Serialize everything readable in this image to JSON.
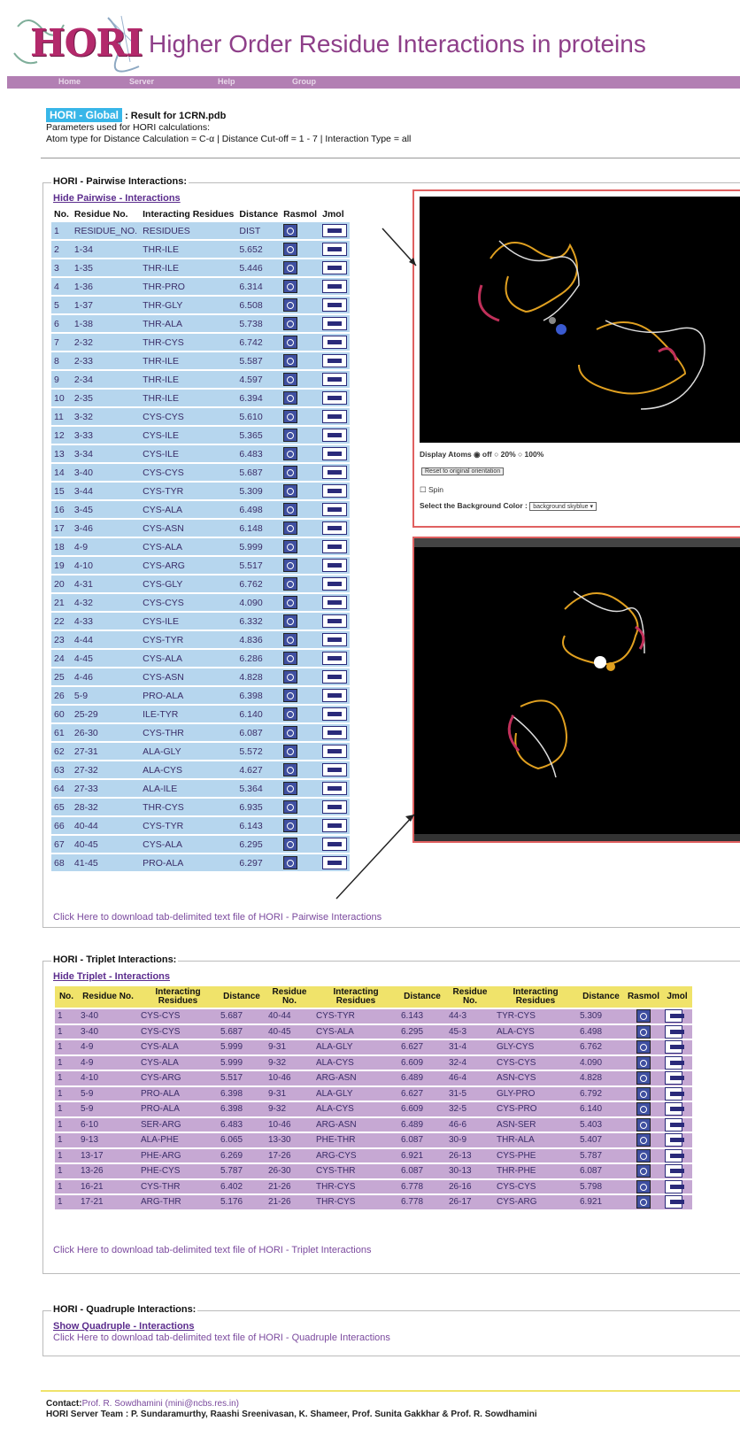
{
  "header": {
    "logo_text": "HORI",
    "title": "Higher Order Residue Interactions in proteins",
    "nav": [
      "Home",
      "Server",
      "Help",
      "Group"
    ]
  },
  "result": {
    "badge": "HORI - Global",
    "title": ": Result for 1CRN.pdb",
    "params_line1": "Parameters used for HORI calculations:",
    "params_line2": "Atom type for Distance Calculation = C-α | Distance Cut-off = 1 - 7 | Interaction Type = all"
  },
  "pairwise": {
    "legend": "HORI - Pairwise Interactions:",
    "toggle": "Hide Pairwise - Interactions",
    "headers": [
      "No.",
      "Residue No.",
      "Interacting Residues",
      "Distance",
      "Rasmol",
      "Jmol"
    ],
    "rows": [
      [
        "1",
        "RESIDUE_NO.",
        "RESIDUES",
        "DIST"
      ],
      [
        "2",
        "1-34",
        "THR-ILE",
        "5.652"
      ],
      [
        "3",
        "1-35",
        "THR-ILE",
        "5.446"
      ],
      [
        "4",
        "1-36",
        "THR-PRO",
        "6.314"
      ],
      [
        "5",
        "1-37",
        "THR-GLY",
        "6.508"
      ],
      [
        "6",
        "1-38",
        "THR-ALA",
        "5.738"
      ],
      [
        "7",
        "2-32",
        "THR-CYS",
        "6.742"
      ],
      [
        "8",
        "2-33",
        "THR-ILE",
        "5.587"
      ],
      [
        "9",
        "2-34",
        "THR-ILE",
        "4.597"
      ],
      [
        "10",
        "2-35",
        "THR-ILE",
        "6.394"
      ],
      [
        "11",
        "3-32",
        "CYS-CYS",
        "5.610"
      ],
      [
        "12",
        "3-33",
        "CYS-ILE",
        "5.365"
      ],
      [
        "13",
        "3-34",
        "CYS-ILE",
        "6.483"
      ],
      [
        "14",
        "3-40",
        "CYS-CYS",
        "5.687"
      ],
      [
        "15",
        "3-44",
        "CYS-TYR",
        "5.309"
      ],
      [
        "16",
        "3-45",
        "CYS-ALA",
        "6.498"
      ],
      [
        "17",
        "3-46",
        "CYS-ASN",
        "6.148"
      ],
      [
        "18",
        "4-9",
        "CYS-ALA",
        "5.999"
      ],
      [
        "19",
        "4-10",
        "CYS-ARG",
        "5.517"
      ],
      [
        "20",
        "4-31",
        "CYS-GLY",
        "6.762"
      ],
      [
        "21",
        "4-32",
        "CYS-CYS",
        "4.090"
      ],
      [
        "22",
        "4-33",
        "CYS-ILE",
        "6.332"
      ],
      [
        "23",
        "4-44",
        "CYS-TYR",
        "4.836"
      ],
      [
        "24",
        "4-45",
        "CYS-ALA",
        "6.286"
      ],
      [
        "25",
        "4-46",
        "CYS-ASN",
        "4.828"
      ],
      [
        "26",
        "5-9",
        "PRO-ALA",
        "6.398"
      ],
      [
        "60",
        "25-29",
        "ILE-TYR",
        "6.140"
      ],
      [
        "61",
        "26-30",
        "CYS-THR",
        "6.087"
      ],
      [
        "62",
        "27-31",
        "ALA-GLY",
        "5.572"
      ],
      [
        "63",
        "27-32",
        "ALA-CYS",
        "4.627"
      ],
      [
        "64",
        "27-33",
        "ALA-ILE",
        "5.364"
      ],
      [
        "65",
        "28-32",
        "THR-CYS",
        "6.935"
      ],
      [
        "66",
        "40-44",
        "CYS-TYR",
        "6.143"
      ],
      [
        "67",
        "40-45",
        "CYS-ALA",
        "6.295"
      ],
      [
        "68",
        "41-45",
        "PRO-ALA",
        "6.297"
      ]
    ],
    "download": "Click Here to download tab-delimited text file of HORI - Pairwise Interactions"
  },
  "viewer": {
    "display_atoms": "Display Atoms",
    "opt_off": "off",
    "opt_20": "20%",
    "opt_100": "100%",
    "reset_button": "Reset to original orientation",
    "spin": "Spin",
    "bg_label": "Select the Background Color :",
    "bg_value": "background skyblue"
  },
  "triplet": {
    "legend": "HORI - Triplet Interactions:",
    "toggle": "Hide Triplet - Interactions",
    "headers": [
      "No.",
      "Residue No.",
      "Interacting Residues",
      "Distance",
      "Residue No.",
      "Interacting Residues",
      "Distance",
      "Residue No.",
      "Interacting Residues",
      "Distance",
      "Rasmol",
      "Jmol"
    ],
    "rows": [
      [
        "1",
        "3-40",
        "CYS-CYS",
        "5.687",
        "40-44",
        "CYS-TYR",
        "6.143",
        "44-3",
        "TYR-CYS",
        "5.309"
      ],
      [
        "1",
        "3-40",
        "CYS-CYS",
        "5.687",
        "40-45",
        "CYS-ALA",
        "6.295",
        "45-3",
        "ALA-CYS",
        "6.498"
      ],
      [
        "1",
        "4-9",
        "CYS-ALA",
        "5.999",
        "9-31",
        "ALA-GLY",
        "6.627",
        "31-4",
        "GLY-CYS",
        "6.762"
      ],
      [
        "1",
        "4-9",
        "CYS-ALA",
        "5.999",
        "9-32",
        "ALA-CYS",
        "6.609",
        "32-4",
        "CYS-CYS",
        "4.090"
      ],
      [
        "1",
        "4-10",
        "CYS-ARG",
        "5.517",
        "10-46",
        "ARG-ASN",
        "6.489",
        "46-4",
        "ASN-CYS",
        "4.828"
      ],
      [
        "1",
        "5-9",
        "PRO-ALA",
        "6.398",
        "9-31",
        "ALA-GLY",
        "6.627",
        "31-5",
        "GLY-PRO",
        "6.792"
      ],
      [
        "1",
        "5-9",
        "PRO-ALA",
        "6.398",
        "9-32",
        "ALA-CYS",
        "6.609",
        "32-5",
        "CYS-PRO",
        "6.140"
      ],
      [
        "1",
        "6-10",
        "SER-ARG",
        "6.483",
        "10-46",
        "ARG-ASN",
        "6.489",
        "46-6",
        "ASN-SER",
        "5.403"
      ],
      [
        "1",
        "9-13",
        "ALA-PHE",
        "6.065",
        "13-30",
        "PHE-THR",
        "6.087",
        "30-9",
        "THR-ALA",
        "5.407"
      ],
      [
        "1",
        "13-17",
        "PHE-ARG",
        "6.269",
        "17-26",
        "ARG-CYS",
        "6.921",
        "26-13",
        "CYS-PHE",
        "5.787"
      ],
      [
        "1",
        "13-26",
        "PHE-CYS",
        "5.787",
        "26-30",
        "CYS-THR",
        "6.087",
        "30-13",
        "THR-PHE",
        "6.087"
      ],
      [
        "1",
        "16-21",
        "CYS-THR",
        "6.402",
        "21-26",
        "THR-CYS",
        "6.778",
        "26-16",
        "CYS-CYS",
        "5.798"
      ],
      [
        "1",
        "17-21",
        "ARG-THR",
        "5.176",
        "21-26",
        "THR-CYS",
        "6.778",
        "26-17",
        "CYS-ARG",
        "6.921"
      ]
    ],
    "download": "Click Here to download tab-delimited text file of HORI - Triplet Interactions"
  },
  "quadruple": {
    "legend": "HORI - Quadruple Interactions:",
    "toggle": "Show Quadruple - Interactions",
    "download": "Click Here to download tab-delimited text file of HORI - Quadruple Interactions"
  },
  "footer": {
    "contact_label": "Contact:",
    "contact_name": "Prof. R. Sowdhamini (mini@ncbs.res.in)",
    "team": "HORI Server Team : P. Sundaramurthy, Raashi Sreenivasan, K. Shameer, Prof. Sunita Gakkhar & Prof. R. Sowdhamini"
  }
}
